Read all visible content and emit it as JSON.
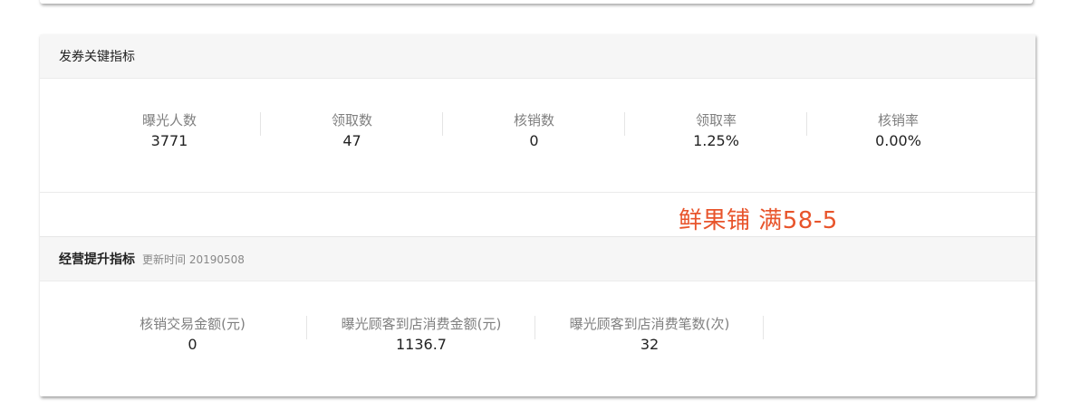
{
  "coupon_section": {
    "title": "发券关键指标",
    "metrics": [
      {
        "label": "曝光人数",
        "value": "3771"
      },
      {
        "label": "领取数",
        "value": "47"
      },
      {
        "label": "核销数",
        "value": "0"
      },
      {
        "label": "领取率",
        "value": "1.25%"
      },
      {
        "label": "核销率",
        "value": "0.00%"
      }
    ]
  },
  "annotation": "鲜果铺 满58-5",
  "business_section": {
    "title": "经营提升指标",
    "update_text": "更新时间 20190508",
    "metrics": [
      {
        "label": "核销交易金额(元)",
        "value": "0"
      },
      {
        "label": "曝光顾客到店消费金额(元)",
        "value": "1136.7"
      },
      {
        "label": "曝光顾客到店消费笔数(次)",
        "value": "32"
      }
    ]
  },
  "colors": {
    "annotation": "#e8542b",
    "header_bg": "#f6f6f6"
  }
}
